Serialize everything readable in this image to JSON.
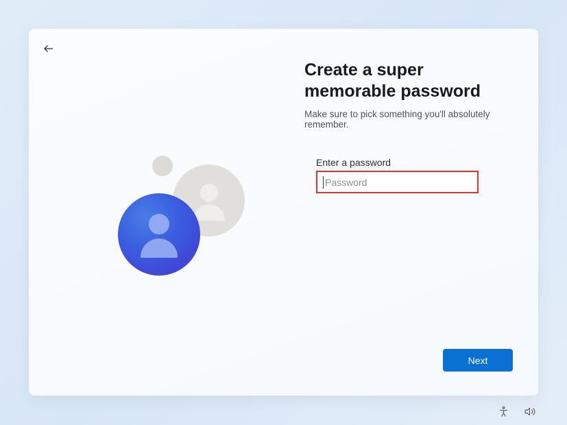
{
  "header": {
    "title": "Create a super memorable password",
    "subtitle": "Make sure to pick something you'll absolutely remember."
  },
  "form": {
    "label": "Enter a password",
    "placeholder": "Password",
    "value": ""
  },
  "actions": {
    "next": "Next"
  },
  "colors": {
    "accent": "#0971d3",
    "error_border": "#e3322a"
  }
}
